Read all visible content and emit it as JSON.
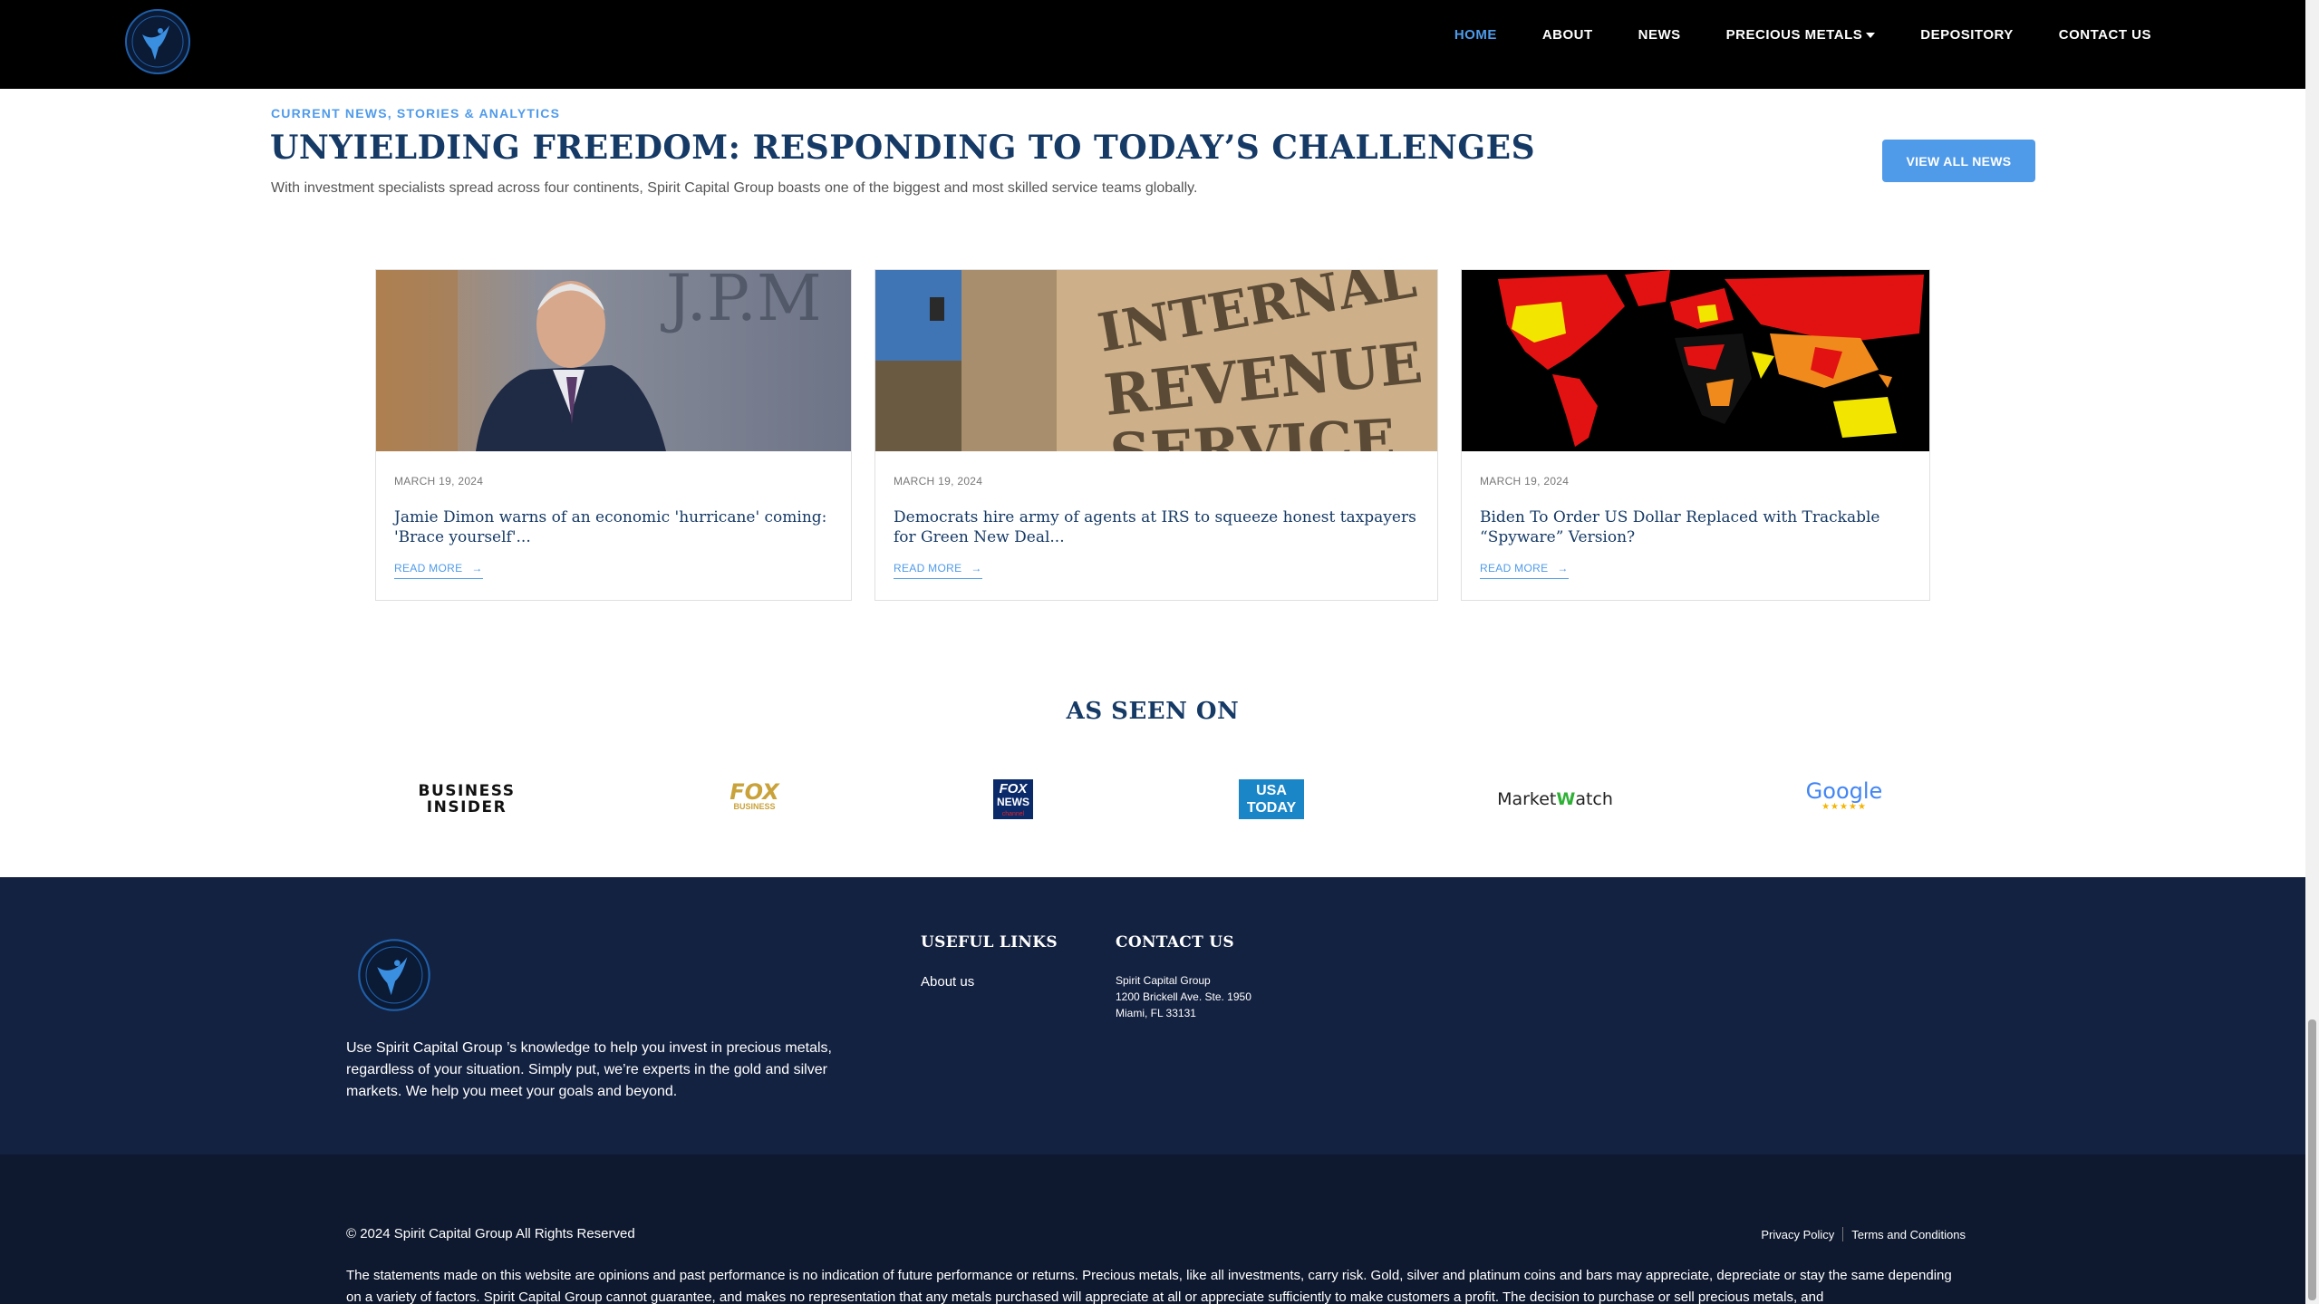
{
  "nav": {
    "items": [
      {
        "label": "HOME",
        "active": true
      },
      {
        "label": "ABOUT"
      },
      {
        "label": "NEWS"
      },
      {
        "label": "PRECIOUS METALS"
      },
      {
        "label": "DEPOSITORY"
      },
      {
        "label": "CONTACT US"
      }
    ]
  },
  "news": {
    "eyebrow": "CURRENT NEWS, STORIES & ANALYTICS",
    "headline": "UNYIELDING FREEDOM: RESPONDING TO TODAY’S CHALLENGES",
    "subhead": "With investment specialists spread across four continents, Spirit Capital Group boasts one of the biggest and most skilled service teams globally.",
    "view_all": "VIEW ALL NEWS",
    "cards": [
      {
        "date": "MARCH 19, 2024",
        "title": "Jamie Dimon warns of an economic 'hurricane' coming: 'Brace yourself'...",
        "read_more": "READ MORE",
        "image": "jamie-dimon-photo",
        "image_text": "J.P.M"
      },
      {
        "date": "MARCH 19, 2024",
        "title": "Democrats hire army of agents at IRS to squeeze honest taxpayers for Green New Deal...",
        "read_more": "READ MORE",
        "image": "irs-building-photo",
        "image_text_lines": [
          "INTERNAL",
          "REVENUE",
          "SERVICE"
        ]
      },
      {
        "date": "MARCH 19, 2024",
        "title": "Biden To Order US Dollar Replaced with Trackable “Spyware” Version?",
        "read_more": "READ MORE",
        "image": "world-map-heatmap"
      }
    ]
  },
  "seen_on": {
    "title": "AS SEEN ON",
    "logos": [
      {
        "name": "business-insider-logo",
        "lines": [
          "BUSINESS",
          "INSIDER"
        ]
      },
      {
        "name": "fox-business-logo",
        "text": "FOX",
        "sub": "BUSINESS"
      },
      {
        "name": "fox-news-logo",
        "text": "FOX",
        "sub": "NEWS",
        "sub2": "channel"
      },
      {
        "name": "usa-today-logo",
        "lines": [
          "USA",
          "TODAY"
        ]
      },
      {
        "name": "marketwatch-logo",
        "text_a": "Market",
        "text_b": "Watch"
      },
      {
        "name": "google-reviews-logo",
        "text": "Google",
        "stars": "★★★★★"
      }
    ]
  },
  "footer": {
    "about": "Use Spirit Capital Group ’s knowledge to help you invest in precious metals, regardless of your situation. Simply put, we’re experts in the gold and silver markets. We help you meet your goals and beyond.",
    "useful_links_heading": "USEFUL LINKS",
    "useful_links": [
      "About us"
    ],
    "contact_heading": "CONTACT US",
    "address": [
      "Spirit Capital Group",
      "1200 Brickell Ave. Ste. 1950",
      "Miami, FL 33131"
    ],
    "copyright": "© 2024 Spirit Capital Group All Rights Reserved",
    "privacy": "Privacy Policy",
    "terms": "Terms and Conditions",
    "disclaimer": "The statements made on this website are opinions and past performance is no indication of future performance or returns. Precious metals, like all investments, carry risk. Gold, silver and platinum coins and bars may appreciate, depreciate or stay the same depending on a variety of factors. Spirit Capital Group cannot guarantee, and makes no representation that any metals purchased will appreciate at all or appreciate sufficiently to make customers a profit. The decision to purchase or sell precious metals, and"
  },
  "colors": {
    "accent": "#4f9bea",
    "navy": "#163a66",
    "footer_top": "#142241",
    "footer_bottom": "#0e192f"
  }
}
